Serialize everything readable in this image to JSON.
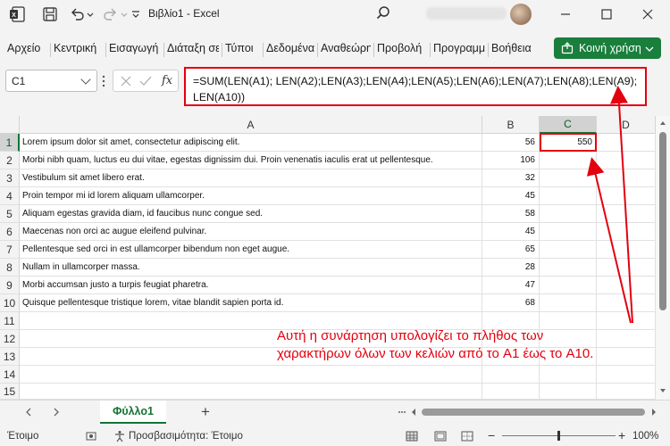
{
  "titlebar": {
    "title": "Βιβλίο1  -  Excel"
  },
  "ribbon": {
    "tabs": [
      "Αρχείο",
      "Κεντρική",
      "Εισαγωγή",
      "Διάταξη σελίδας",
      "Τύποι",
      "Δεδομένα",
      "Αναθεώρηση",
      "Προβολή",
      "Προγραμματιστής",
      "Βοήθεια"
    ],
    "share_label": "Κοινή χρήση"
  },
  "formula_bar": {
    "name_box": "C1",
    "fx_label": "fx",
    "formula": "=SUM(LEN(A1); LEN(A2);LEN(A3);LEN(A4);LEN(A5);LEN(A6);LEN(A7);LEN(A8);LEN(A9);LEN(A10))"
  },
  "grid": {
    "columns": [
      "A",
      "B",
      "C",
      "D"
    ],
    "row_numbers": [
      "1",
      "2",
      "3",
      "4",
      "5",
      "6",
      "7",
      "8",
      "9",
      "10",
      "11",
      "12",
      "13",
      "14",
      "15"
    ],
    "rows": [
      {
        "a": "Lorem ipsum dolor sit amet, consectetur adipiscing elit.",
        "b": "56",
        "c": "550"
      },
      {
        "a": "Morbi nibh quam, luctus eu dui vitae, egestas dignissim dui. Proin venenatis iaculis erat ut pellentesque.",
        "b": "106",
        "c": ""
      },
      {
        "a": "Vestibulum sit amet libero erat.",
        "b": "32",
        "c": ""
      },
      {
        "a": "Proin tempor mi id lorem aliquam ullamcorper.",
        "b": "45",
        "c": ""
      },
      {
        "a": "Aliquam egestas gravida diam, id faucibus nunc congue sed.",
        "b": "58",
        "c": ""
      },
      {
        "a": "Maecenas non orci ac augue eleifend pulvinar.",
        "b": "45",
        "c": ""
      },
      {
        "a": "Pellentesque sed orci in est ullamcorper bibendum non eget augue.",
        "b": "65",
        "c": ""
      },
      {
        "a": "Nullam in ullamcorper massa.",
        "b": "28",
        "c": ""
      },
      {
        "a": "Morbi accumsan justo a turpis feugiat pharetra.",
        "b": "47",
        "c": ""
      },
      {
        "a": "Quisque pellentesque tristique lorem, vitae blandit sapien porta id.",
        "b": "68",
        "c": ""
      }
    ]
  },
  "annotation": {
    "text": "Αυτή η συνάρτηση υπολογίζει το πλήθος των χαρακτήρων όλων των κελιών από το A1 έως το A10."
  },
  "sheets": {
    "active": "Φύλλο1",
    "add_symbol": "+"
  },
  "status": {
    "ready": "Έτοιμο",
    "accessibility": "Προσβασιμότητα: Έτοιμο",
    "zoom": "100%"
  },
  "colors": {
    "excel_green": "#137333",
    "highlight_red": "#e3000f"
  }
}
